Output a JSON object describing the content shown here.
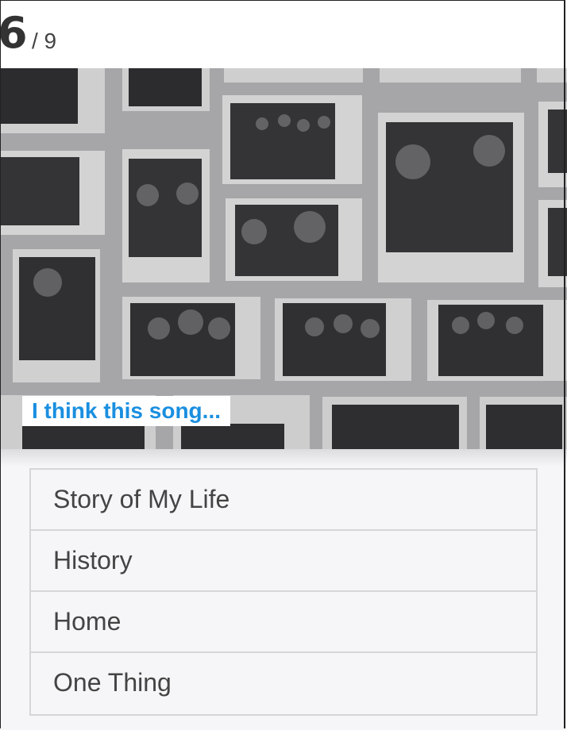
{
  "counter": {
    "current": "6",
    "total": "/ 9"
  },
  "question": {
    "caption": "I think this song..."
  },
  "answers": [
    {
      "label": "Story of My Life"
    },
    {
      "label": "History"
    },
    {
      "label": "Home"
    },
    {
      "label": "One Thing"
    }
  ],
  "colors": {
    "caption_text": "#1a8fe0",
    "answer_text": "#444444",
    "border": "#d6d6d8"
  }
}
